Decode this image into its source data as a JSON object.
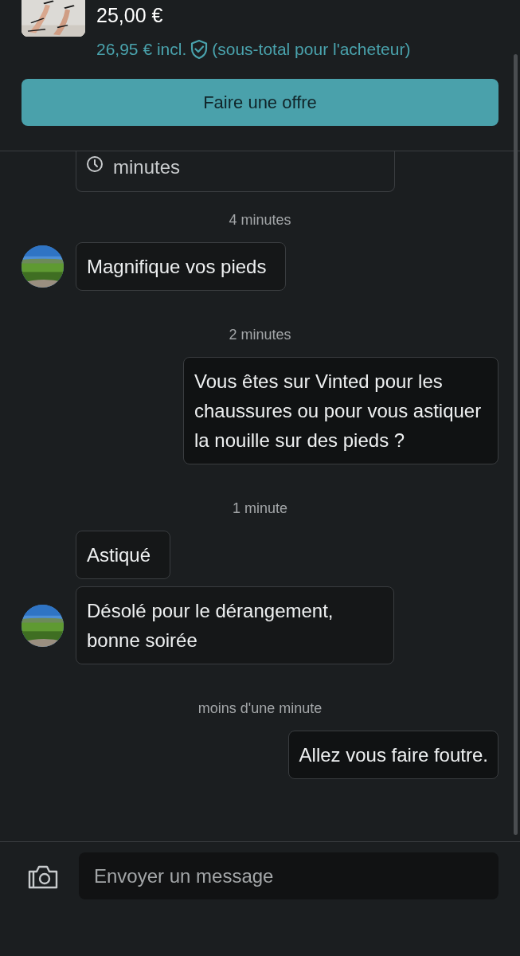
{
  "product": {
    "price": "25,00 €",
    "total": "26,95 € incl.",
    "total_note": "(sous-total pour l'acheteur)"
  },
  "offer_button": "Faire une offre",
  "messages": [
    {
      "kind": "status",
      "text": "minutes"
    },
    {
      "kind": "time",
      "text": "4 minutes"
    },
    {
      "kind": "incoming",
      "text": "Magnifique vos pieds",
      "avatar": true
    },
    {
      "kind": "time",
      "text": "2 minutes"
    },
    {
      "kind": "outgoing",
      "text": "Vous êtes sur Vinted pour les chaussures ou pour vous astiquer la nouille sur des pieds ?"
    },
    {
      "kind": "time",
      "text": "1 minute"
    },
    {
      "kind": "incoming",
      "text": "Astiqué",
      "avatar": false
    },
    {
      "kind": "incoming",
      "text": "Désolé pour le dérangement, bonne soirée",
      "avatar": true
    },
    {
      "kind": "time",
      "text": "moins d'une minute"
    },
    {
      "kind": "outgoing",
      "text": "Allez vous faire foutre."
    }
  ],
  "composer": {
    "placeholder": "Envoyer un message"
  }
}
